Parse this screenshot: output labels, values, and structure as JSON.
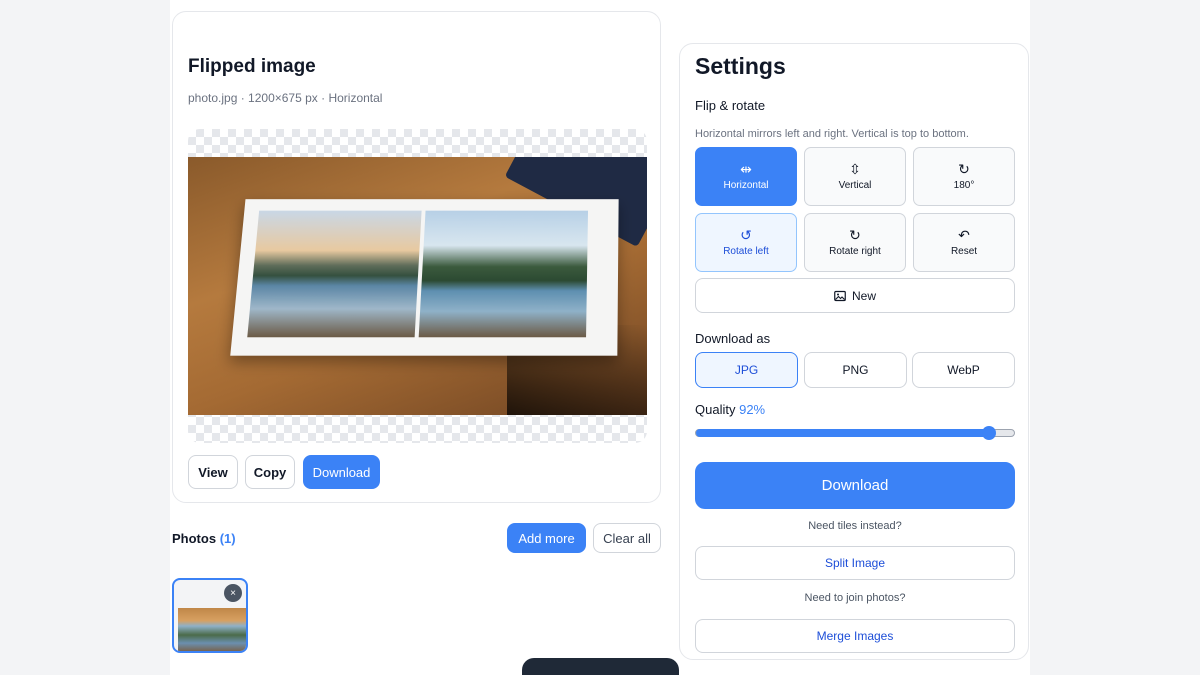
{
  "preview": {
    "title": "Flipped image",
    "meta": "photo.jpg · 1200×675 px · Horizontal",
    "actions": {
      "view": "View",
      "copy": "Copy",
      "download": "Download"
    }
  },
  "photos": {
    "label": "Photos",
    "count": "(1)",
    "add_more": "Add more",
    "clear_all": "Clear all",
    "remove_glyph": "×"
  },
  "settings": {
    "title": "Settings",
    "flip_section": "Flip & rotate",
    "flip_hint": "Horizontal mirrors left and right. Vertical is top to bottom.",
    "tiles": [
      {
        "label": "Horizontal",
        "icon": "flip-horizontal-icon",
        "glyph": "⇹",
        "state": "active"
      },
      {
        "label": "Vertical",
        "icon": "flip-vertical-icon",
        "glyph": "⇳",
        "state": "default"
      },
      {
        "label": "180°",
        "icon": "rotate-180-icon",
        "glyph": "↻",
        "state": "default"
      },
      {
        "label": "Rotate left",
        "icon": "rotate-left-icon",
        "glyph": "↺",
        "state": "soft"
      },
      {
        "label": "Rotate right",
        "icon": "rotate-right-icon",
        "glyph": "↻",
        "state": "default"
      },
      {
        "label": "Reset",
        "icon": "reset-icon",
        "glyph": "↶",
        "state": "default"
      }
    ],
    "new_label": "New",
    "download_as": "Download as",
    "formats": [
      {
        "label": "JPG",
        "selected": true
      },
      {
        "label": "PNG",
        "selected": false
      },
      {
        "label": "WebP",
        "selected": false
      }
    ],
    "quality_label": "Quality",
    "quality_value": "92%",
    "quality_percent": 92,
    "download_label": "Download",
    "tiles_hint": "Need tiles instead?",
    "split_label": "Split Image",
    "join_hint": "Need to join photos?",
    "merge_label": "Merge Images"
  },
  "colors": {
    "accent": "#3b82f6",
    "accent_dark": "#1d4ed8",
    "border": "#d1d5db"
  }
}
